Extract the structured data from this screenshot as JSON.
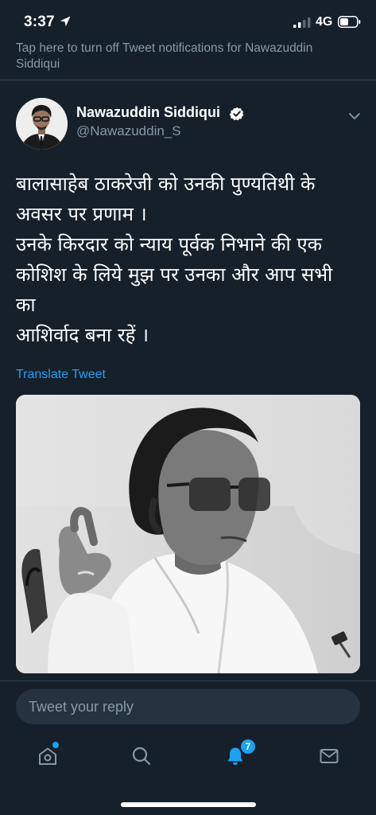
{
  "status_bar": {
    "time": "3:37",
    "network": "4G",
    "icons": [
      "location-arrow-icon",
      "signal-icon",
      "battery-icon"
    ]
  },
  "notification_banner": {
    "text": "Tap here to turn off Tweet notifications for Nawazuddin Siddiqui"
  },
  "tweet": {
    "author": {
      "name": "Nawazuddin Siddiqui",
      "handle": "@Nawazuddin_S",
      "verified": true
    },
    "text_lines": [
      "बालासाहेब ठाकरेजी को उनकी पुण्यतिथी के",
      "अवसर पर प्रणाम ।",
      "उनके किरदार को न्याय पूर्वक निभाने की एक",
      "कोशिश के लिये मुझ पर उनका और आप सभी",
      "का",
      "आशिर्वाद बना रहें ।"
    ],
    "translate_label": "Translate Tweet",
    "photo": {
      "style": "black-and-white"
    }
  },
  "reply": {
    "placeholder": "Tweet your reply",
    "value": ""
  },
  "tab_bar": {
    "items": [
      {
        "name": "home",
        "icon": "home-icon",
        "has_dot": true
      },
      {
        "name": "search",
        "icon": "search-icon"
      },
      {
        "name": "notifications",
        "icon": "bell-icon",
        "badge": "7",
        "active": true
      },
      {
        "name": "messages",
        "icon": "envelope-icon"
      }
    ]
  },
  "colors": {
    "background": "#15202b",
    "accent": "#1da1f2",
    "secondary_text": "#8899a6",
    "divider": "#38444d",
    "input_background": "#253341"
  }
}
